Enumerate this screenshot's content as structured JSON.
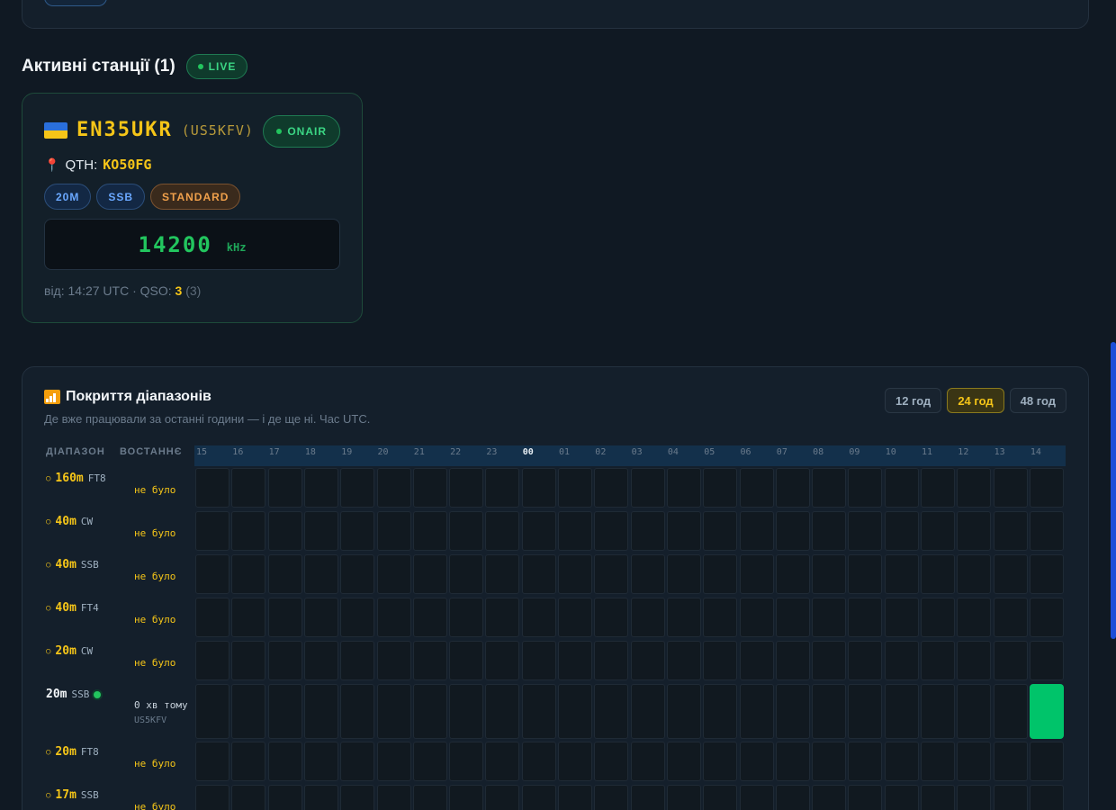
{
  "section": {
    "title": "Активні станції (1)",
    "live_label": "LIVE"
  },
  "station": {
    "flag": "ukraine-flag",
    "callsign": "EN35UKR",
    "operator": "(US5KFV)",
    "status": "ONAIR",
    "qth_label": "QTH:",
    "qth": "KO50FG",
    "tags": [
      "20M",
      "SSB",
      "STANDARD"
    ],
    "frequency": "14200",
    "unit": "kHz",
    "since": "від: 14:27 UTC · QSO:",
    "qso_count": "3",
    "qso_sub": "(3)"
  },
  "coverage": {
    "title": "Покриття діапазонів",
    "subtitle": "Де вже працювали за останні години — і де ще ні. Час UTC.",
    "ranges": [
      "12 год",
      "24 год",
      "48 год"
    ],
    "active_range": "24 год",
    "col_band": "ДІАПАЗОН",
    "col_last": "ВОСТАННЄ",
    "hours": [
      "15",
      "16",
      "17",
      "18",
      "19",
      "20",
      "21",
      "22",
      "23",
      "00",
      "01",
      "02",
      "03",
      "04",
      "05",
      "06",
      "07",
      "08",
      "09",
      "10",
      "11",
      "12",
      "13",
      "14"
    ],
    "rows": [
      {
        "band": "160m",
        "mode": "FT8",
        "last": "не було",
        "active": false,
        "callsign": "",
        "on_hours": []
      },
      {
        "band": "40m",
        "mode": "CW",
        "last": "не було",
        "active": false,
        "callsign": "",
        "on_hours": []
      },
      {
        "band": "40m",
        "mode": "SSB",
        "last": "не було",
        "active": false,
        "callsign": "",
        "on_hours": []
      },
      {
        "band": "40m",
        "mode": "FT4",
        "last": "не було",
        "active": false,
        "callsign": "",
        "on_hours": []
      },
      {
        "band": "20m",
        "mode": "CW",
        "last": "не було",
        "active": false,
        "callsign": "",
        "on_hours": []
      },
      {
        "band": "20m",
        "mode": "SSB",
        "last": "0 хв тому",
        "active": true,
        "callsign": "US5KFV",
        "on_hours": [
          "14"
        ]
      },
      {
        "band": "20m",
        "mode": "FT8",
        "last": "не було",
        "active": false,
        "callsign": "",
        "on_hours": []
      },
      {
        "band": "17m",
        "mode": "SSB",
        "last": "не було",
        "active": false,
        "callsign": "",
        "on_hours": []
      }
    ]
  }
}
